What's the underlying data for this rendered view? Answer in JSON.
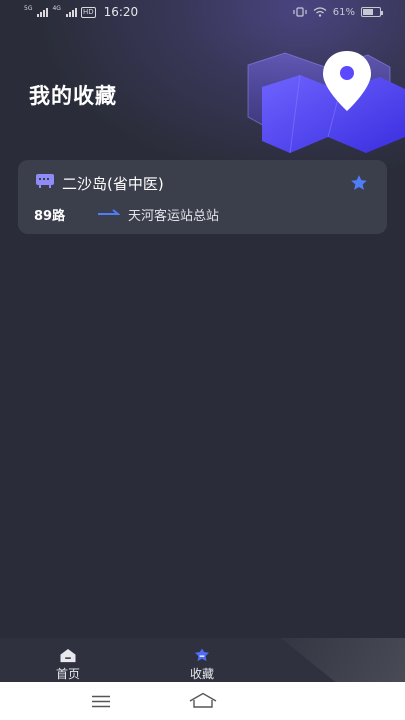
{
  "status_bar": {
    "sim1": "5G",
    "sim2": "4G",
    "hd": "HD",
    "time": "16:20",
    "battery": "61%",
    "battery_level": 0.61
  },
  "page_title": "我的收藏",
  "favorites": [
    {
      "stop_name": "二沙岛(省中医)",
      "route": "89路",
      "destination": "天河客运站总站",
      "starred": true
    }
  ],
  "tabs": [
    {
      "label": "首页",
      "icon": "home-icon",
      "active": false
    },
    {
      "label": "收藏",
      "icon": "favorites-icon",
      "active": true
    }
  ],
  "colors": {
    "background": "#2a2d39",
    "card": "#3b3e4b",
    "accent": "#4f6cf7",
    "hero_purple": "#5a49ff"
  }
}
